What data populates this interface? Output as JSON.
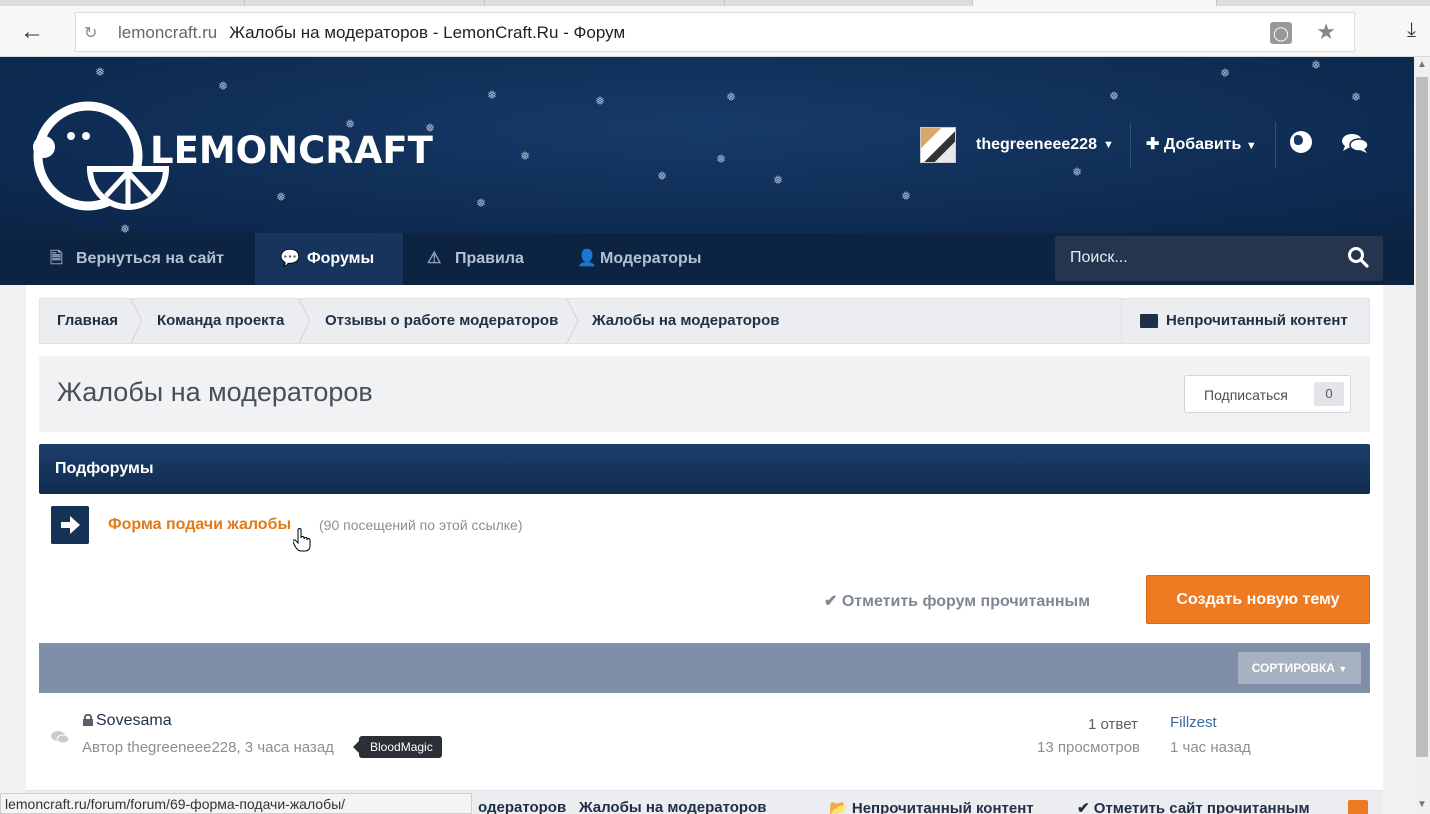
{
  "browser": {
    "url": "lemoncraft.ru",
    "page_title": "Жалобы на модераторов - LemonCraft.Ru - Форум",
    "status_url": "lemoncraft.ru/forum/forum/69-форма-подачи-жалобы/"
  },
  "header": {
    "logo_text": "LEMONCRAFT",
    "username": "thegreeneee228",
    "add_label": "Добавить"
  },
  "nav": {
    "items": [
      {
        "label": "Вернуться на сайт"
      },
      {
        "label": "Форумы"
      },
      {
        "label": "Правила"
      },
      {
        "label": "Модераторы"
      }
    ],
    "search_placeholder": "Поиск..."
  },
  "breadcrumb": {
    "items": [
      "Главная",
      "Команда проекта",
      "Отзывы о работе модераторов",
      "Жалобы на модераторов"
    ],
    "unread_label": "Непрочитанный контент"
  },
  "page": {
    "title": "Жалобы на модераторов",
    "follow_label": "Подписаться",
    "follow_count": "0"
  },
  "subforums": {
    "heading": "Подфорумы",
    "redirect_title": "Форма подачи жалобы",
    "redirect_meta": "(90 посещений по этой ссылке)"
  },
  "actions": {
    "mark_read": "Отметить форум прочитанным",
    "new_topic": "Создать новую тему",
    "sort": "СОРТИРОВКА"
  },
  "topics": [
    {
      "title": "Sovesama",
      "meta": "Автор thegreeneee228, 3 часа назад",
      "tag": "BloodMagic",
      "replies": "1 ответ",
      "views": "13 просмотров",
      "last_user": "Fillzest",
      "last_time": "1 час назад"
    }
  ],
  "bottom_bar": {
    "crumb_partial": "одераторов",
    "crumb_last": "Жалобы на модераторов",
    "unread": "Непрочитанный контент",
    "mark_site": "Отметить сайт прочитанным"
  }
}
